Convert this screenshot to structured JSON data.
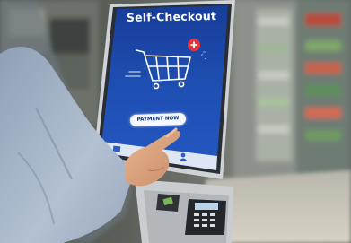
{
  "kiosk": {
    "title": "Self-Checkout",
    "payment_button_label": "PAYMENT NOW",
    "screen_color": "#1e4aa8",
    "accent_color": "#e8333a"
  },
  "icons": [
    "shopping-cart-icon",
    "plus-badge-icon",
    "card-icon",
    "person-icon",
    "card-reader"
  ]
}
